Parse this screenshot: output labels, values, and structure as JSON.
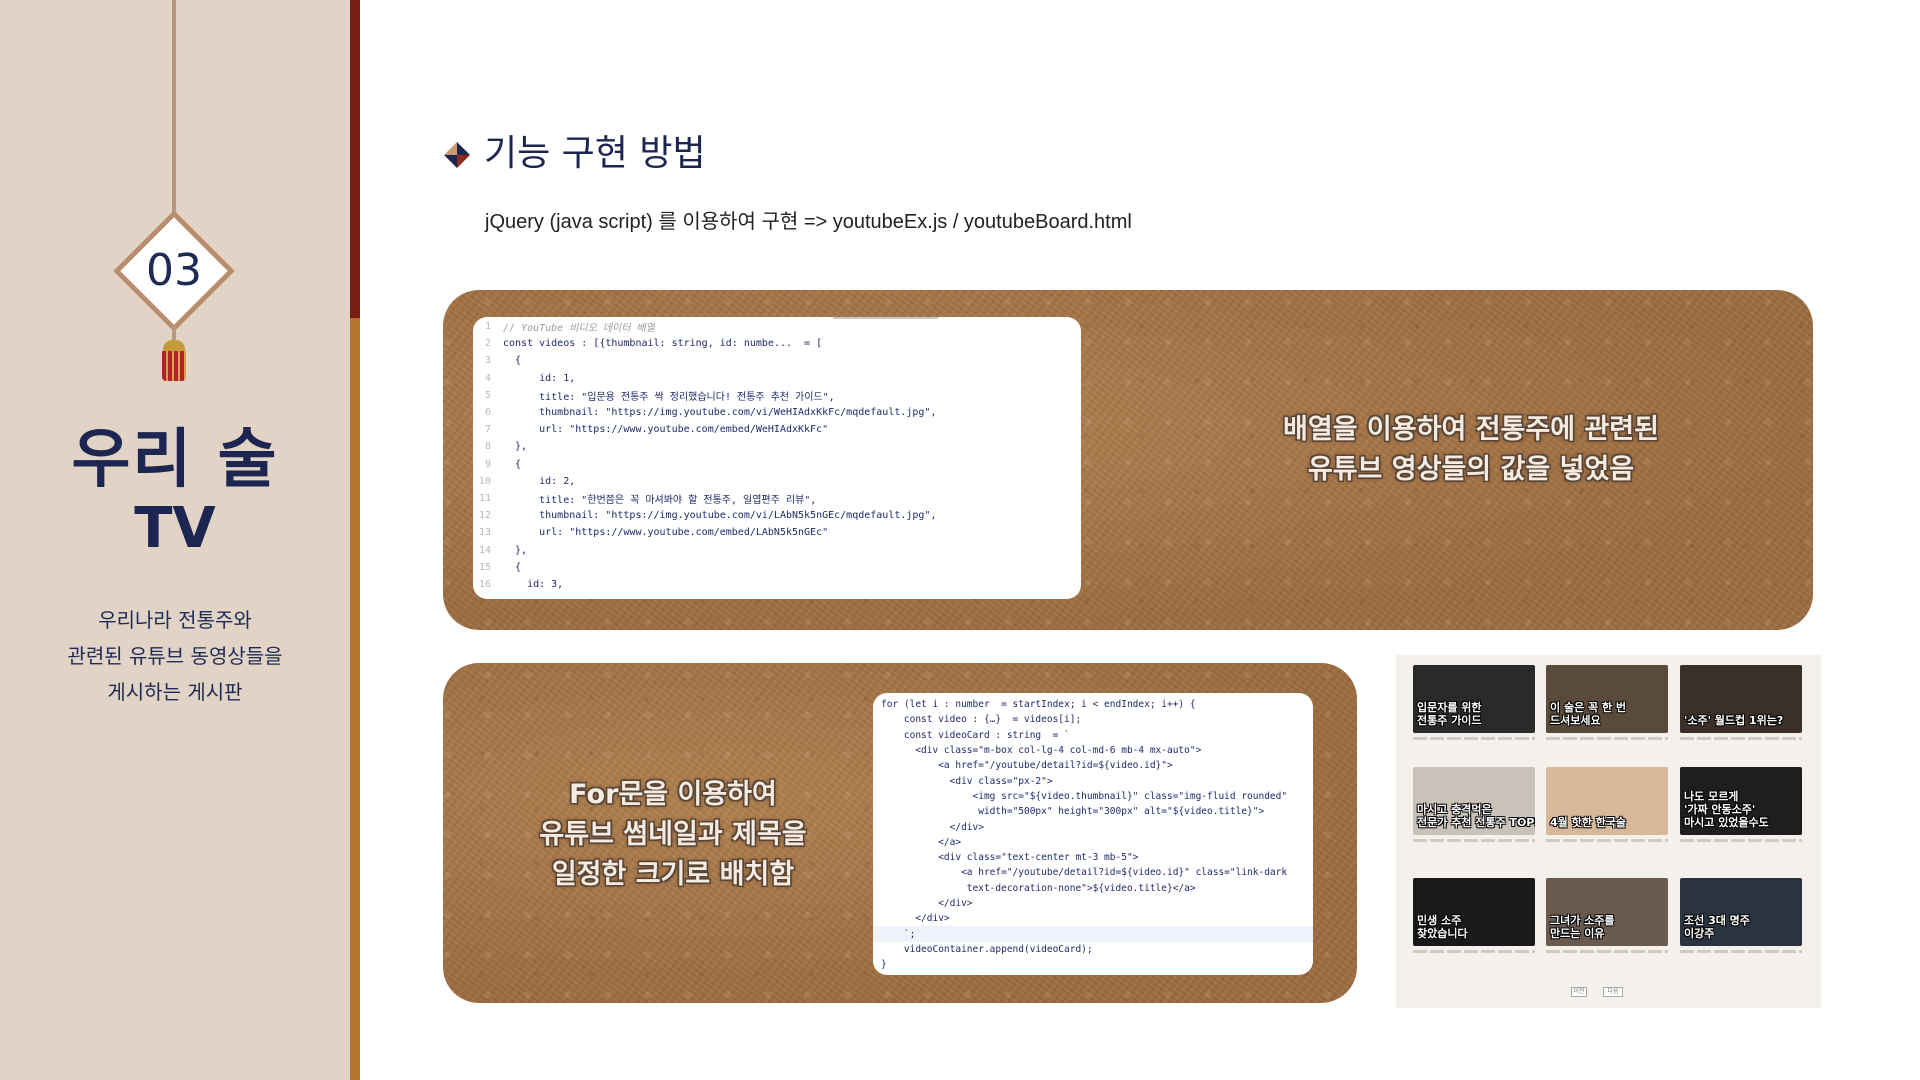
{
  "sidebar": {
    "number": "03",
    "title_line1": "우리 술",
    "title_line2": "TV",
    "description": [
      "우리나라 전통주와",
      "관련된 유튜브 동영상들을",
      "게시하는 게시판"
    ]
  },
  "header": {
    "section_icon": "diamond-icon",
    "title": "기능 구현 방법",
    "subtitle": "jQuery (java script) 를 이용하여 구현 => youtubeEx.js / youtubeBoard.html"
  },
  "panel_top": {
    "caption": [
      "배열을 이용하여 전통주에 관련된",
      "유튜브 영상들의 값을 넣었음"
    ],
    "code_lines": [
      {
        "n": "1",
        "text": "// YouTube 비디오 데이터 배열"
      },
      {
        "n": "2",
        "text": "const videos : [{thumbnail: string, id: numbe...  = ["
      },
      {
        "n": "3",
        "text": "  {"
      },
      {
        "n": "4",
        "text": "      id: 1,"
      },
      {
        "n": "5",
        "text": "      title: \"입문용 전통주 싹 정리했습니다! 전통주 추천 가이드\","
      },
      {
        "n": "6",
        "text": "      thumbnail: \"https://img.youtube.com/vi/WeHIAdxKkFc/mqdefault.jpg\","
      },
      {
        "n": "7",
        "text": "      url: \"https://www.youtube.com/embed/WeHIAdxKkFc\""
      },
      {
        "n": "8",
        "text": "  },"
      },
      {
        "n": "9",
        "text": "  {"
      },
      {
        "n": "10",
        "text": "      id: 2,"
      },
      {
        "n": "11",
        "text": "      title: \"한번쯤은 꼭 마셔봐야 할 전통주, 일엽편주 리뷰\","
      },
      {
        "n": "12",
        "text": "      thumbnail: \"https://img.youtube.com/vi/LAbN5k5nGEc/mqdefault.jpg\","
      },
      {
        "n": "13",
        "text": "      url: \"https://www.youtube.com/embed/LAbN5k5nGEc\""
      },
      {
        "n": "14",
        "text": "  },"
      },
      {
        "n": "15",
        "text": "  {"
      },
      {
        "n": "16",
        "text": "    id: 3,"
      }
    ]
  },
  "panel_bottom": {
    "caption": [
      "For문을 이용하여",
      "유튜브 썸네일과 제목을",
      "일정한 크기로 배치함"
    ],
    "code_lines": [
      "for (let i : number  = startIndex; i < endIndex; i++) {",
      "    const video : {…}  = videos[i];",
      "    const videoCard : string  = `",
      "      <div class=\"m-box col-lg-4 col-md-6 mb-4 mx-auto\">",
      "          <a href=\"/youtube/detail?id=${video.id}\">",
      "            <div class=\"px-2\">",
      "                <img src=\"${video.thumbnail}\" class=\"img-fluid rounded\"",
      "                 width=\"500px\" height=\"300px\" alt=\"${video.title}\">",
      "            </div>",
      "          </a>",
      "          <div class=\"text-center mt-3 mb-5\">",
      "              <a href=\"/youtube/detail?id=${video.id}\" class=\"link-dark",
      "               text-decoration-none\">${video.title}</a>",
      "          </div>",
      "      </div>",
      "    `;",
      "    videoContainer.append(videoCard);",
      "}"
    ]
  },
  "screenshot": {
    "thumbnails": [
      {
        "label": "입문자를 위한\n전통주 가이드",
        "bg": "#2a2a2a"
      },
      {
        "label": "이 술은 꼭 한 번\n드셔보세요",
        "bg": "#5a4a3a"
      },
      {
        "label": "'소주' 월드컵 1위는?",
        "bg": "#3a3028"
      },
      {
        "label": "마시고 충격먹은\n전문가 추천 전통주 TOP5",
        "bg": "#c9c2b8"
      },
      {
        "label": "4월 핫한 한국술",
        "bg": "#d8b89a"
      },
      {
        "label": "나도 모르게\n'가짜 안동소주'\n마시고 있었을수도",
        "bg": "#1e1e1e"
      },
      {
        "label": "민생 소주\n찾았습니다",
        "bg": "#1a1a1a"
      },
      {
        "label": "그녀가 소주를\n만드는 이유",
        "bg": "#6a5a4e"
      },
      {
        "label": "조선 3대 명주\n이강주",
        "bg": "#2a3440"
      }
    ],
    "pager": [
      "이전",
      "다음"
    ]
  }
}
